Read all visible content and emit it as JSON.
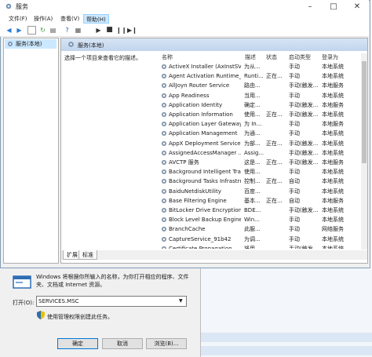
{
  "window": {
    "title": "服务",
    "menu": [
      "文件(F)",
      "操作(A)",
      "查看(V)",
      "帮助(H)"
    ],
    "active_menu_index": 3
  },
  "tree": {
    "selected_label": "服务(本地)"
  },
  "pane": {
    "header": "服务(本地)",
    "description": "选择一个项目来查看它的描述。",
    "columns": [
      "名称",
      "描述",
      "状态",
      "启动类型",
      "登录为"
    ],
    "rows": [
      {
        "name": "ActiveX Installer (AxInstSV)",
        "desc": "为从...",
        "status": "",
        "startup": "手动",
        "logon": "本地系统"
      },
      {
        "name": "Agent Activation Runtime_...",
        "desc": "Runti...",
        "status": "正在...",
        "startup": "手动",
        "logon": "本地系统"
      },
      {
        "name": "AllJoyn Router Service",
        "desc": "路由...",
        "status": "",
        "startup": "手动(触发...",
        "logon": "本地服务"
      },
      {
        "name": "App Readiness",
        "desc": "当用...",
        "status": "",
        "startup": "手动",
        "logon": "本地系统"
      },
      {
        "name": "Application Identity",
        "desc": "确定...",
        "status": "",
        "startup": "手动(触发...",
        "logon": "本地服务"
      },
      {
        "name": "Application Information",
        "desc": "使用...",
        "status": "正在...",
        "startup": "手动(触发...",
        "logon": "本地系统"
      },
      {
        "name": "Application Layer Gateway ...",
        "desc": "为 In...",
        "status": "",
        "startup": "手动",
        "logon": "本地服务"
      },
      {
        "name": "Application Management",
        "desc": "为通...",
        "status": "",
        "startup": "手动",
        "logon": "本地系统"
      },
      {
        "name": "AppX Deployment Service ...",
        "desc": "为部...",
        "status": "正在...",
        "startup": "手动(触发...",
        "logon": "本地系统"
      },
      {
        "name": "AssignedAccessManager ...",
        "desc": "Assig...",
        "status": "",
        "startup": "手动(触发...",
        "logon": "本地系统"
      },
      {
        "name": "AVCTP 服务",
        "desc": "这是...",
        "status": "正在...",
        "startup": "手动(触发...",
        "logon": "本地服务"
      },
      {
        "name": "Background Intelligent Tra...",
        "desc": "使用...",
        "status": "",
        "startup": "手动",
        "logon": "本地系统"
      },
      {
        "name": "Background Tasks Infrastru...",
        "desc": "控制...",
        "status": "正在...",
        "startup": "自动",
        "logon": "本地系统"
      },
      {
        "name": "BaiduNetdiskUtility",
        "desc": "百度...",
        "status": "",
        "startup": "手动",
        "logon": "本地系统"
      },
      {
        "name": "Base Filtering Engine",
        "desc": "基本...",
        "status": "正在...",
        "startup": "自动",
        "logon": "本地服务"
      },
      {
        "name": "BitLocker Drive Encryption ...",
        "desc": "BDE...",
        "status": "",
        "startup": "手动(触发...",
        "logon": "本地系统"
      },
      {
        "name": "Block Level Backup Engine ...",
        "desc": "Win...",
        "status": "",
        "startup": "手动",
        "logon": "本地系统"
      },
      {
        "name": "BranchCache",
        "desc": "此服...",
        "status": "",
        "startup": "手动",
        "logon": "网络服务"
      },
      {
        "name": "CaptureService_91b42",
        "desc": "为调...",
        "status": "",
        "startup": "手动",
        "logon": "本地系统"
      },
      {
        "name": "Certificate Propagation",
        "desc": "将用...",
        "status": "",
        "startup": "手动(触发...",
        "logon": "本地系统"
      }
    ],
    "tabs": [
      "扩展",
      "标准"
    ],
    "active_tab_index": 0
  },
  "run_dialog": {
    "description": "Windows 将根据你所输入的名称，为你打开相应的程序、文件夹、文档或 Internet 资源。",
    "open_label": "打开(O):",
    "open_value": "SERVICES.MSC",
    "admin_text": "使用管理权限创建此任务。",
    "buttons": {
      "ok": "确定",
      "cancel": "取消",
      "browse": "浏览(B)..."
    }
  }
}
